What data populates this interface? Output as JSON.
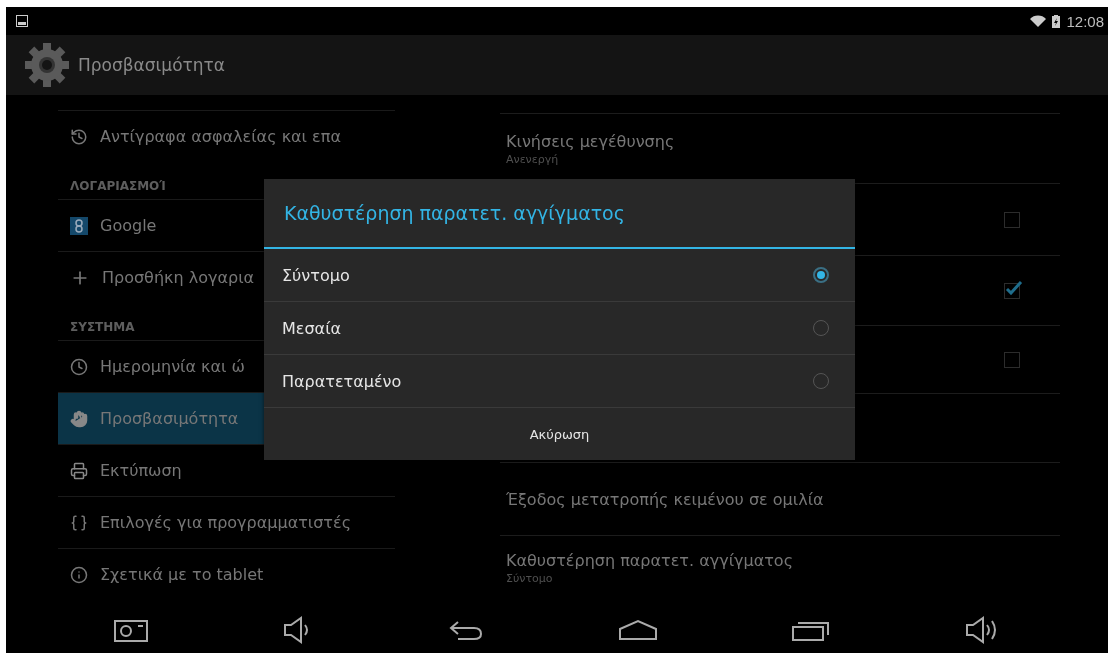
{
  "status_bar": {
    "time": "12:08"
  },
  "action_bar": {
    "title": "Προσβασιμότητα"
  },
  "sidebar": {
    "items": [
      {
        "kind": "item",
        "label": "Αντίγραφα ασφαλείας και επα",
        "selected": false
      },
      {
        "kind": "header",
        "label": "ΛΟΓΑΡΙΑΣΜΟΊ"
      },
      {
        "kind": "item",
        "label": "Google",
        "selected": false
      },
      {
        "kind": "item",
        "label": "Προσθήκη λογαρια",
        "selected": false
      },
      {
        "kind": "header",
        "label": "ΣΥΣΤΗΜΑ"
      },
      {
        "kind": "item",
        "label": "Ημερομηνία και ώ",
        "selected": false
      },
      {
        "kind": "item",
        "label": "Προσβασιμότητα",
        "selected": true
      },
      {
        "kind": "item",
        "label": "Εκτύπωση",
        "selected": false
      },
      {
        "kind": "item",
        "label": "Επιλογές για προγραμματιστές",
        "selected": false
      },
      {
        "kind": "item",
        "label": "Σχετικά με το tablet",
        "selected": false
      }
    ]
  },
  "settings": [
    {
      "kind": "text",
      "title": "Κινήσεις μεγέθυνσης",
      "summary": "Ανενεργή"
    },
    {
      "kind": "checkbox",
      "checked": false
    },
    {
      "kind": "checkbox",
      "checked": true
    },
    {
      "kind": "checkbox",
      "checked": false
    },
    {
      "kind": "empty"
    },
    {
      "kind": "text",
      "title": "Έξοδος μετατροπής κειμένου σε ομιλία"
    },
    {
      "kind": "text",
      "title": "Καθυστέρηση παρατετ. αγγίγματος",
      "summary": "Σύντομο"
    }
  ],
  "dialog": {
    "title": "Καθυστέρηση παρατετ. αγγίγματος",
    "options": [
      {
        "label": "Σύντομο",
        "selected": true
      },
      {
        "label": "Μεσαία",
        "selected": false
      },
      {
        "label": "Παρατεταμένο",
        "selected": false
      }
    ],
    "cancel_button": "Ακύρωση"
  }
}
